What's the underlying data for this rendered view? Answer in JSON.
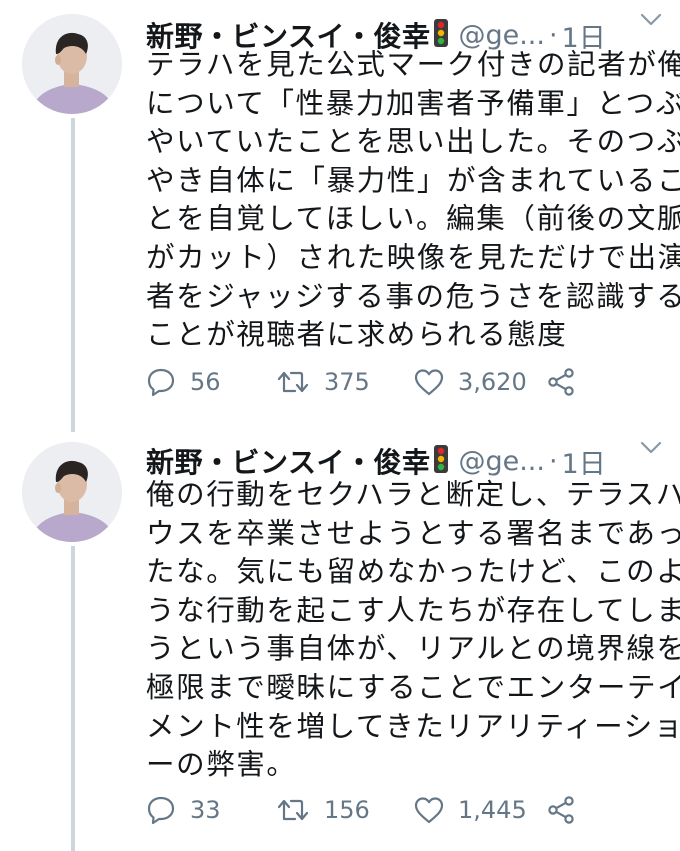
{
  "colors": {
    "text": "#14171a",
    "muted": "#657786",
    "thread_line": "#ccd6dd"
  },
  "tweets": [
    {
      "display_name": "新野・ビンスイ・俊幸",
      "handle": "@ge...",
      "separator": "·",
      "time": "1日",
      "badge_icon": "traffic-light-icon",
      "lines": [
        "テラハを見た公式マーク付きの記者が俺",
        "について「性暴力加害者予備軍」とつぶ",
        "やいていたことを思い出した。そのつぶ",
        "やき自体に「暴力性」が含まれているこ",
        "とを自覚してほしい。編集（前後の文脈",
        "がカット）された映像を見ただけで出演",
        "者をジャッジする事の危うさを認識する",
        "ことが視聴者に求められる態度"
      ],
      "replies": "56",
      "retweets": "375",
      "likes": "3,620"
    },
    {
      "display_name": "新野・ビンスイ・俊幸",
      "handle": "@ge...",
      "separator": "·",
      "time": "1日",
      "badge_icon": "traffic-light-icon",
      "lines": [
        "俺の行動をセクハラと断定し、テラスハ",
        "ウスを卒業させようとする署名まであっ",
        "たな。気にも留めなかったけど、このよ",
        "うな行動を起こす人たちが存在してしま",
        "うという事自体が、リアルとの境界線を",
        "極限まで曖昧にすることでエンターテイ",
        "メント性を増してきたリアリティーショ",
        "ーの弊害。"
      ],
      "replies": "33",
      "retweets": "156",
      "likes": "1,445"
    }
  ]
}
